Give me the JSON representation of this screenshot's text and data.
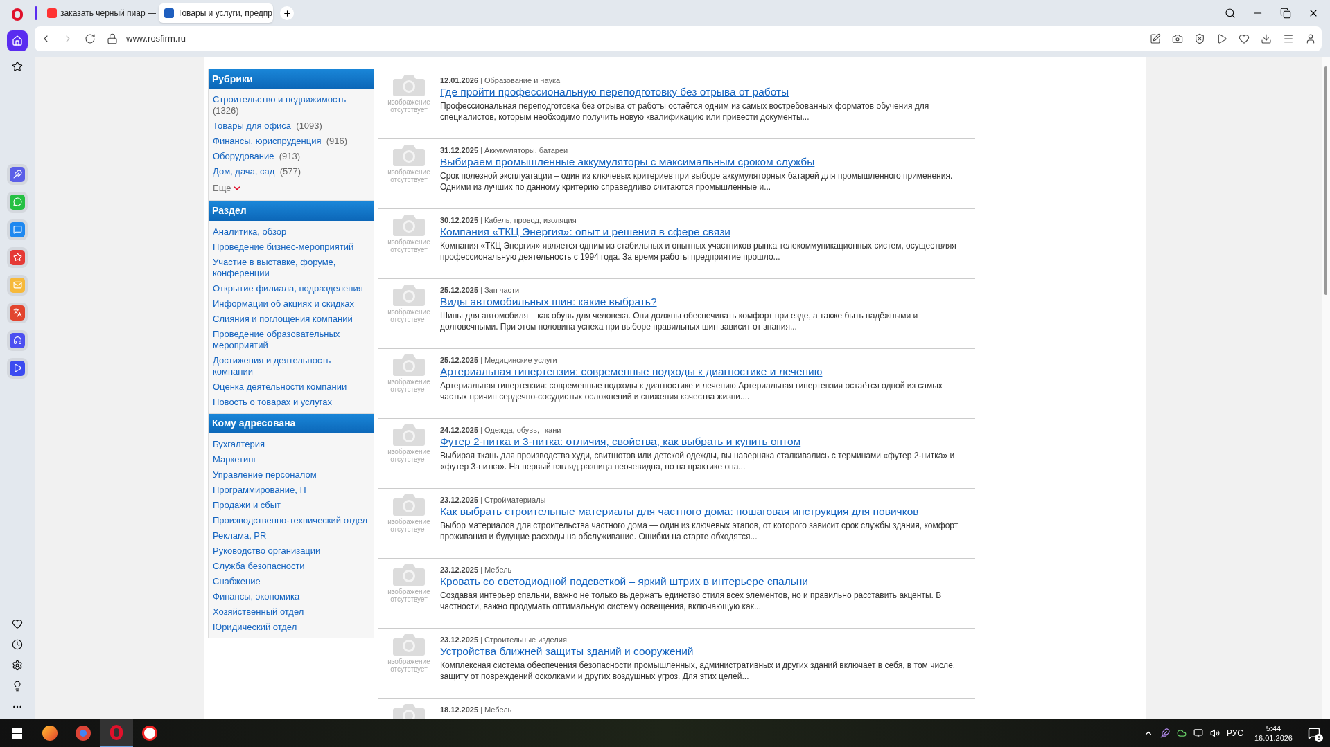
{
  "browser": {
    "tabs": [
      {
        "title": "заказать черный пиар —",
        "color": "#ff3333",
        "selected": false
      },
      {
        "title": "Товары и услуги, предпр",
        "color": "#1f5fbf",
        "selected": true
      }
    ],
    "url": "www.rosfirm.ru"
  },
  "sidebar": [
    {
      "title": "Рубрики",
      "items": [
        {
          "label": "Строительство и недвижимость",
          "count": "(1326)"
        },
        {
          "label": "Товары для офиса",
          "count": "(1093)"
        },
        {
          "label": "Финансы, юриспруденция",
          "count": "(916)"
        },
        {
          "label": "Оборудование",
          "count": "(913)"
        },
        {
          "label": "Дом, дача, сад",
          "count": "(577)"
        }
      ],
      "more": "Еще"
    },
    {
      "title": "Раздел",
      "items": [
        {
          "label": "Аналитика, обзор"
        },
        {
          "label": "Проведение бизнес-мероприятий"
        },
        {
          "label": "Участие в выставке, форуме, конференции"
        },
        {
          "label": "Открытие филиала, подразделения"
        },
        {
          "label": "Информации об акциях и скидках"
        },
        {
          "label": "Слияния и поглощения компаний"
        },
        {
          "label": "Проведение образовательных мероприятий"
        },
        {
          "label": "Достижения и деятельность компании"
        },
        {
          "label": "Оценка деятельности компании"
        },
        {
          "label": "Новость о товарах и услугах"
        }
      ]
    },
    {
      "title": "Кому адресована",
      "items": [
        {
          "label": "Бухгалтерия"
        },
        {
          "label": "Маркетинг"
        },
        {
          "label": "Управление персоналом"
        },
        {
          "label": "Программирование, IT"
        },
        {
          "label": "Продажи и сбыт"
        },
        {
          "label": "Производственно-технический отдел"
        },
        {
          "label": "Реклама, PR"
        },
        {
          "label": "Руководство организации"
        },
        {
          "label": "Служба безопасности"
        },
        {
          "label": "Снабжение"
        },
        {
          "label": "Финансы, экономика"
        },
        {
          "label": "Хозяйственный отдел"
        },
        {
          "label": "Юридический отдел"
        }
      ]
    }
  ],
  "articles": [
    {
      "image_note": "изображение отсутствует",
      "date": "12.01.2026",
      "separator": "|",
      "category": "Образование и наука",
      "title": "Где пройти профессиональную переподготовку без отрыва от работы",
      "excerpt": "Профессиональная переподготовка без отрыва от работы остаётся одним из самых востребованных форматов обучения для специалистов, которым необходимо получить новую квалификацию или привести документы..."
    },
    {
      "image_note": "изображение отсутствует",
      "date": "31.12.2025",
      "separator": "|",
      "category": "Аккумуляторы, батареи",
      "title": "Выбираем промышленные аккумуляторы с максимальным сроком службы",
      "excerpt": "Срок полезной эксплуатации – один из ключевых критериев при выборе аккумуляторных батарей для промышленного применения. Одними из лучших по данному критерию справедливо считаются промышленные и..."
    },
    {
      "image_note": "изображение отсутствует",
      "date": "30.12.2025",
      "separator": "|",
      "category": "Кабель, провод, изоляция",
      "title": "Компания «ТКЦ Энергия»: опыт и решения в сфере связи",
      "excerpt": "Компания «ТКЦ Энергия» является одним из стабильных и опытных участников рынка телекоммуникационных систем, осуществляя профессиональную деятельность с 1994 года. За время работы предприятие прошло..."
    },
    {
      "image_note": "изображение отсутствует",
      "date": "25.12.2025",
      "separator": "|",
      "category": "Зап части",
      "title": "Виды автомобильных шин: какие выбрать?",
      "excerpt": "Шины для автомобиля – как обувь для человека. Они должны обеспечивать комфорт при езде, а также быть надёжными и долговечными. При этом половина успеха при выборе правильных шин зависит от знания..."
    },
    {
      "image_note": "изображение отсутствует",
      "date": "25.12.2025",
      "separator": "|",
      "category": "Медицинские услуги",
      "title": "Артериальная гипертензия: современные подходы к диагностике и лечению",
      "excerpt": "Артериальная гипертензия: современные подходы к диагностике и лечению Артериальная гипертензия остаётся одной из самых частых причин сердечно-сосудистых осложнений и снижения качества жизни...."
    },
    {
      "image_note": "изображение отсутствует",
      "date": "24.12.2025",
      "separator": "|",
      "category": "Одежда, обувь, ткани",
      "title": "Футер 2-нитка и 3-нитка: отличия, свойства, как выбрать и купить оптом",
      "excerpt": "Выбирая ткань для производства худи, свитшотов или детской одежды, вы наверняка сталкивались с терминами «футер 2-нитка» и «футер 3-нитка». На первый взгляд разница неочевидна, но на практике она..."
    },
    {
      "image_note": "изображение отсутствует",
      "date": "23.12.2025",
      "separator": "|",
      "category": "Стройматериалы",
      "title": "Как выбрать строительные материалы для частного дома: пошаговая инструкция для новичков",
      "excerpt": "Выбор материалов для строительства частного дома — один из ключевых этапов, от которого зависит срок службы здания, комфорт проживания и будущие расходы на обслуживание. Ошибки на старте обходятся..."
    },
    {
      "image_note": "изображение отсутствует",
      "date": "23.12.2025",
      "separator": "|",
      "category": "Мебель",
      "title": "Кровать со светодиодной подсветкой – яркий штрих в интерьере спальни",
      "excerpt": "Создавая интерьер спальни, важно не только выдержать единство стиля всех элементов, но и правильно расставить акценты. В частности, важно продумать оптимальную систему освещения, включающую как..."
    },
    {
      "image_note": "изображение отсутствует",
      "date": "23.12.2025",
      "separator": "|",
      "category": "Строительные изделия",
      "title": "Устройства ближней защиты зданий и сооружений",
      "excerpt": "Комплексная система обеспечения безопасности промышленных, административных и других зданий включает в себя, в том числе, защиту от повреждений осколками и других воздушных угроз. Для этих целей..."
    },
    {
      "date": "18.12.2025",
      "separator": "|",
      "category": "Мебель"
    }
  ],
  "taskbar": {
    "language": "РУС",
    "time": "5:44",
    "date": "16.01.2026",
    "notifications": "5"
  }
}
